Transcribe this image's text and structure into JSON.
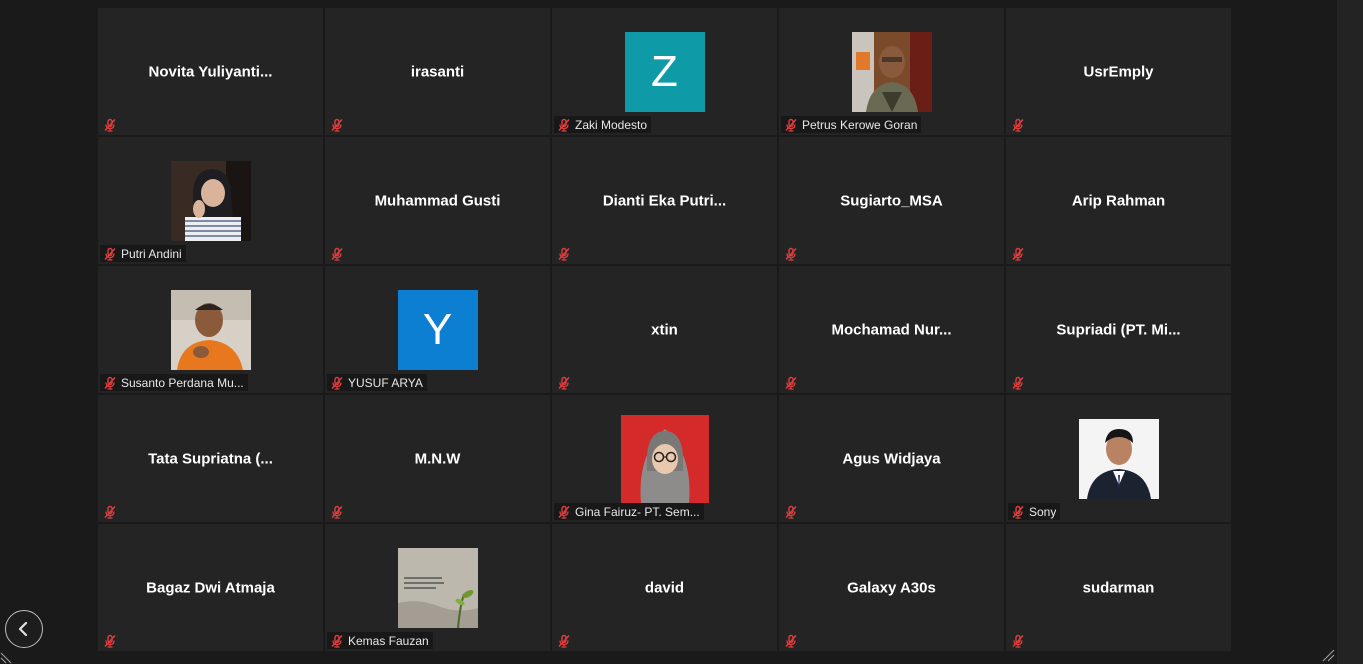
{
  "participants": [
    {
      "name": "Novita  Yuliyanti...",
      "label": "",
      "avatar": null
    },
    {
      "name": "irasanti",
      "label": "",
      "avatar": null
    },
    {
      "name": "",
      "label": "Zaki Modesto",
      "avatar": {
        "type": "letter",
        "letter": "Z",
        "color": "#0e9aa7"
      }
    },
    {
      "name": "",
      "label": "Petrus Kerowe Goran",
      "avatar": {
        "type": "photo",
        "icon": "photo-man-glasses"
      }
    },
    {
      "name": "UsrEmply",
      "label": "",
      "avatar": null
    },
    {
      "name": "",
      "label": "Putri Andini",
      "avatar": {
        "type": "photo",
        "icon": "photo-woman-hijab-striped"
      }
    },
    {
      "name": "Muhammad Gusti",
      "label": "",
      "avatar": null
    },
    {
      "name": "Dianti  Eka  Putri...",
      "label": "",
      "avatar": null
    },
    {
      "name": "Sugiarto_MSA",
      "label": "",
      "avatar": null
    },
    {
      "name": "Arip Rahman",
      "label": "",
      "avatar": null
    },
    {
      "name": "",
      "label": "Susanto Perdana Mu...",
      "avatar": {
        "type": "photo",
        "icon": "photo-man-orange-shirt"
      }
    },
    {
      "name": "",
      "label": "YUSUF ARYA",
      "avatar": {
        "type": "letter",
        "letter": "Y",
        "color": "#0c7fd3"
      }
    },
    {
      "name": "xtin",
      "label": "",
      "avatar": null
    },
    {
      "name": "Mochamad  Nur...",
      "label": "",
      "avatar": null
    },
    {
      "name": "Supriadi  (PT.  Mi...",
      "label": "",
      "avatar": null
    },
    {
      "name": "Tata  Supriatna  (...",
      "label": "",
      "avatar": null
    },
    {
      "name": "M.N.W",
      "label": "",
      "avatar": null
    },
    {
      "name": "",
      "label": "Gina Fairuz- PT. Sem...",
      "avatar": {
        "type": "photo",
        "icon": "photo-woman-hijab-red-bg"
      }
    },
    {
      "name": "Agus Widjaya",
      "label": "",
      "avatar": null
    },
    {
      "name": "",
      "label": "Sony",
      "avatar": {
        "type": "photo",
        "icon": "photo-man-suit"
      }
    },
    {
      "name": "Bagaz Dwi Atmaja",
      "label": "",
      "avatar": null
    },
    {
      "name": "",
      "label": "Kemas Fauzan",
      "avatar": {
        "type": "photo",
        "icon": "photo-quote-plant",
        "quote": "\"I am prepared for the worst, but hope for the best.\""
      }
    },
    {
      "name": "david",
      "label": "",
      "avatar": null
    },
    {
      "name": "Galaxy A30s",
      "label": "",
      "avatar": null
    },
    {
      "name": "sudarman",
      "label": "",
      "avatar": null
    }
  ],
  "colors": {
    "tile_bg": "#242424",
    "muted_icon": "#e03e3e"
  }
}
